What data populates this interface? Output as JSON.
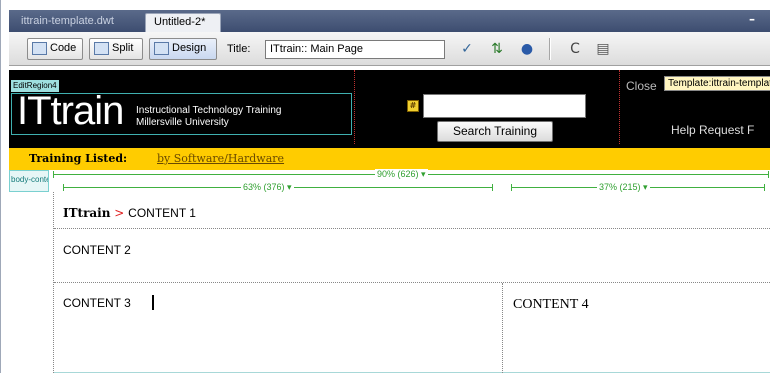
{
  "document_tabs": [
    {
      "label": "ittrain-template.dwt",
      "active": false
    },
    {
      "label": "Untitled-2*",
      "active": true
    }
  ],
  "toolbar": {
    "code_label": "Code",
    "split_label": "Split",
    "design_label": "Design",
    "title_label": "Title:",
    "title_value": "ITtrain:: Main Page",
    "icons": [
      "validate-icon",
      "file-management-icon",
      "preview-browser-icon",
      "refresh-icon",
      "view-options-icon"
    ]
  },
  "header": {
    "edit_region_tag": "EditRegion4",
    "logo_text": "ITtrain",
    "logo_sub1": "Instructional Technology Training",
    "logo_sub2": "Millersville University",
    "search_button": "Search Training",
    "close_text": "Close",
    "template_tag": "Template:ittrain-template",
    "help_text": "Help Request F"
  },
  "nav": {
    "label": "Training Listed:",
    "link": "by Software/Hardware"
  },
  "guides": {
    "body_tag": "body-content",
    "outer_width": "90% (626) ▾",
    "left_width": "63% (376) ▾",
    "right_width": "37% (215) ▾"
  },
  "content": {
    "breadcrumb_home": "ITtrain",
    "breadcrumb_sep": " > ",
    "breadcrumb_text": "CONTENT 1",
    "content2": "CONTENT 2",
    "content3": "CONTENT 3",
    "content4": "CONTENT 4"
  },
  "colors": {
    "header_bg": "#000000",
    "nav_band": "#ffcc00",
    "guide": "#40b040",
    "breadcrumb_sep": "#e02020"
  }
}
